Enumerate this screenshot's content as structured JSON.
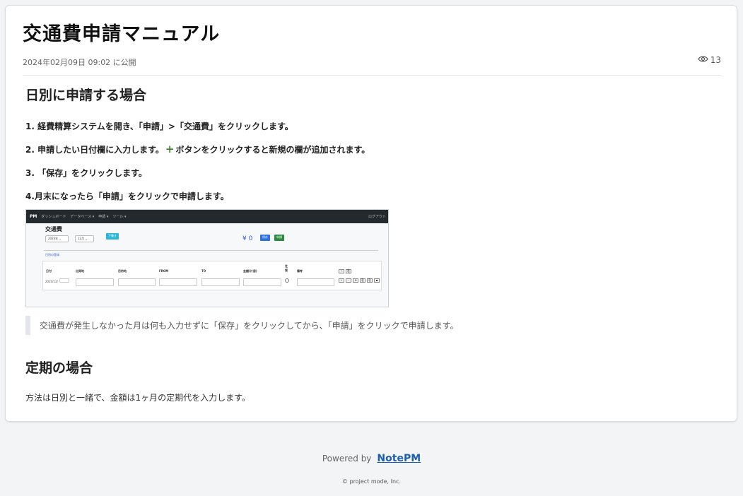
{
  "page": {
    "title": "交通費申請マニュアル",
    "published": "2024年02月09日 09:02 に公開",
    "view_count": "13"
  },
  "section1": {
    "heading": "日別に申請する場合",
    "step1": "1. 経費精算システムを開き、「申請」>「交通費」をクリックします。",
    "step2_before": "2. 申請したい日付欄に入力します。",
    "step2_plus": "+",
    "step2_after": "ボタンをクリックすると新規の欄が追加されます。",
    "step3": "3. 「保存」をクリックします。",
    "step4": "4.月末になったら「申請」をクリックで申請します。",
    "quote": "交通費が発生しなかった月は何も入力せずに「保存」をクリックしてから、「申請」をクリックで申請します。"
  },
  "screenshot": {
    "brand": "PM",
    "nav": [
      "ダッシュボード",
      "データベース ▾",
      "申請 ▾",
      "ツール ▾"
    ],
    "nav_right": "ログアウト",
    "title": "交通費",
    "year": "2023年",
    "month": "12月",
    "download": "下書き",
    "yen": "¥ 0",
    "save": "保存",
    "apply": "申請",
    "link": "日別の登録",
    "headers": [
      "日付",
      "出発地",
      "目的地",
      "FROM",
      "TO",
      "金額(片道)",
      "往復",
      "備考"
    ],
    "date_value": "2023/12/"
  },
  "section2": {
    "heading": "定期の場合",
    "text": "方法は日別と一緒で、金額は1ヶ月の定期代を入力します。"
  },
  "footer": {
    "powered_by": "Powered by",
    "brand": "NotePM",
    "copyright": "© project mode, Inc."
  }
}
